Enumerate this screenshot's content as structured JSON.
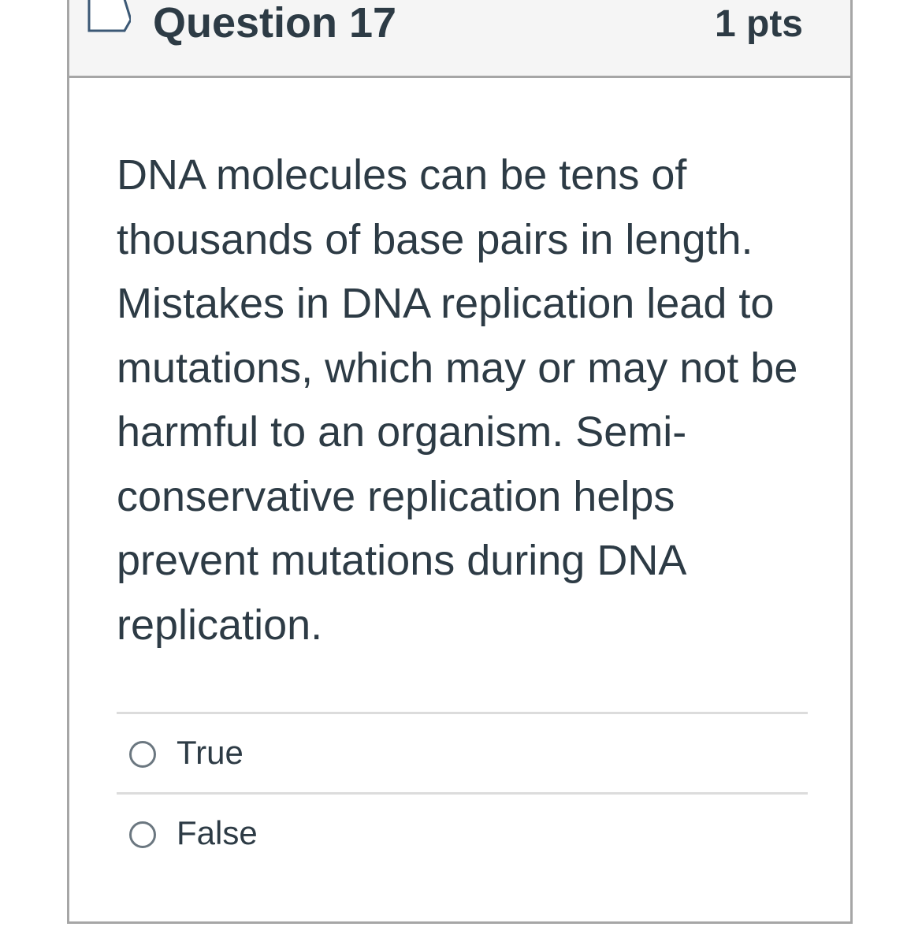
{
  "question": {
    "title": "Question 17",
    "points": "1 pts",
    "text": "DNA molecules can be tens of thousands of base pairs in length. Mistakes in DNA replication lead to mutations, which may or may not be harmful to an organism. Semi-conservative replication helps prevent mutations during DNA replication."
  },
  "answers": [
    {
      "label": "True",
      "selected": false
    },
    {
      "label": "False",
      "selected": false
    }
  ],
  "icons": {
    "flag": "bookmark-flag-icon",
    "radio": "radio-circle-icon"
  },
  "colors": {
    "text": "#2d3b45",
    "header_bg": "#f5f5f5",
    "border": "#a6a6a6",
    "divider": "#dcdcdc"
  }
}
